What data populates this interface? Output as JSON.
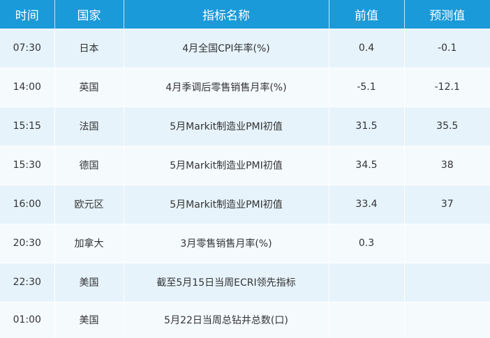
{
  "header": {
    "time": "时间",
    "country": "国家",
    "indicator": "指标名称",
    "previous": "前值",
    "forecast": "预测值"
  },
  "rows": [
    {
      "time": "07:30",
      "country": "日本",
      "indicator": "4月全国CPI年率(%)",
      "previous": "0.4",
      "forecast": "-0.1"
    },
    {
      "time": "14:00",
      "country": "英国",
      "indicator": "4月季调后零售销售月率(%)",
      "previous": "-5.1",
      "forecast": "-12.1"
    },
    {
      "time": "15:15",
      "country": "法国",
      "indicator": "5月Markit制造业PMI初值",
      "previous": "31.5",
      "forecast": "35.5"
    },
    {
      "time": "15:30",
      "country": "德国",
      "indicator": "5月Markit制造业PMI初值",
      "previous": "34.5",
      "forecast": "38"
    },
    {
      "time": "16:00",
      "country": "欧元区",
      "indicator": "5月Markit制造业PMI初值",
      "previous": "33.4",
      "forecast": "37"
    },
    {
      "time": "20:30",
      "country": "加拿大",
      "indicator": "3月零售销售月率(%)",
      "previous": "0.3",
      "forecast": ""
    },
    {
      "time": "22:30",
      "country": "美国",
      "indicator": "截至5月15日当周ECRI领先指标",
      "previous": "",
      "forecast": ""
    },
    {
      "time": "01:00",
      "country": "美国",
      "indicator": "5月22日当周总钻井总数(口)",
      "previous": "",
      "forecast": ""
    }
  ]
}
